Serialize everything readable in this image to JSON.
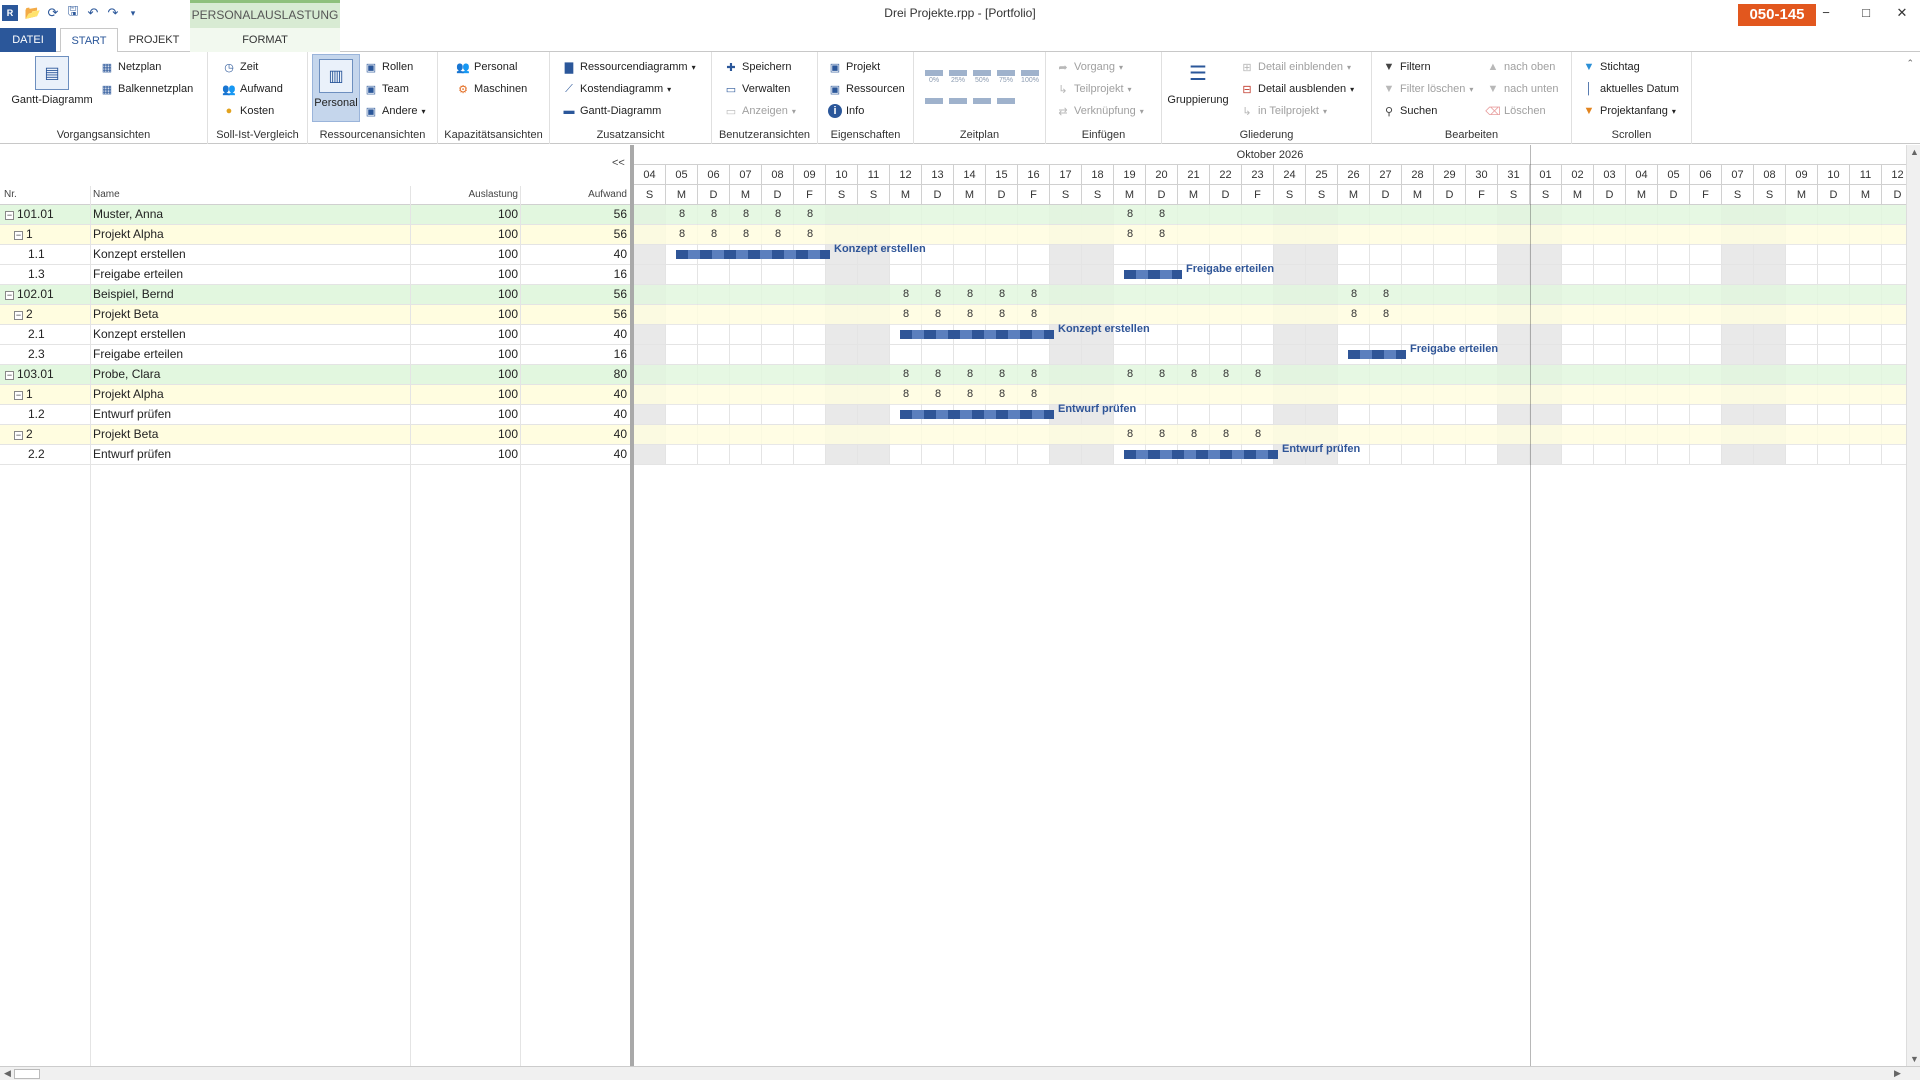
{
  "window": {
    "title": "Drei Projekte.rpp - [Portfolio]",
    "code": "050-145",
    "context_tab": "PERSONALAUSLASTUNG",
    "controls": {
      "min": "−",
      "max": "□",
      "close": "✕"
    }
  },
  "tabs": {
    "datei": "DATEI",
    "start": "START",
    "projekt": "PROJEKT",
    "format": "FORMAT"
  },
  "ribbon": {
    "vorgang": {
      "label": "Vorgangsansichten",
      "gantt": "Gantt-Diagramm",
      "netzplan": "Netzplan",
      "balken": "Balkennetzplan"
    },
    "soll": {
      "label": "Soll-Ist-Vergleich",
      "zeit": "Zeit",
      "aufwand": "Aufwand",
      "kosten": "Kosten"
    },
    "ressourcen": {
      "label": "Ressourcenansichten",
      "personal": "Personal",
      "rollen": "Rollen",
      "team": "Team",
      "andere": "Andere"
    },
    "kapazitaet": {
      "label": "Kapazitätsansichten",
      "personal": "Personal",
      "maschinen": "Maschinen"
    },
    "zusatz": {
      "label": "Zusatzansicht",
      "ressdiag": "Ressourcendiagramm",
      "kostendiag": "Kostendiagramm",
      "gantt": "Gantt-Diagramm"
    },
    "benutzer": {
      "label": "Benutzeransichten",
      "speichern": "Speichern",
      "verwalten": "Verwalten",
      "anzeigen": "Anzeigen"
    },
    "eigen": {
      "label": "Eigenschaften",
      "projekt": "Projekt",
      "ressourcen": "Ressourcen",
      "info": "Info"
    },
    "zeitplan": {
      "label": "Zeitplan",
      "zero": "0%",
      "q25": "25%",
      "q50": "50%",
      "q75": "75%",
      "full": "100%"
    },
    "einfuegen": {
      "label": "Einfügen",
      "vorgang": "Vorgang",
      "teilprojekt": "Teilprojekt",
      "verknuepfung": "Verknüpfung"
    },
    "gliederung": {
      "label": "Gliederung",
      "gruppierung": "Gruppierung",
      "einblenden": "Detail einblenden",
      "ausblenden": "Detail ausblenden",
      "inteil": "in Teilprojekt"
    },
    "bearbeiten": {
      "label": "Bearbeiten",
      "filtern": "Filtern",
      "filterloeschen": "Filter löschen",
      "suchen": "Suchen",
      "oben": "nach oben",
      "unten": "nach unten",
      "loeschen": "Löschen"
    },
    "scrollen": {
      "label": "Scrollen",
      "stichtag": "Stichtag",
      "datum": "aktuelles Datum",
      "anfang": "Projektanfang"
    }
  },
  "grid": {
    "headers": {
      "nr": "Nr.",
      "name": "Name",
      "auslastung": "Auslastung",
      "aufwand": "Aufwand"
    },
    "collapse": "<<",
    "rows": [
      {
        "type": "res",
        "toggle": "−",
        "nr": "101.01",
        "name": "Muster, Anna",
        "auslastung": "100",
        "aufwand": "56"
      },
      {
        "type": "proj",
        "toggle": "−",
        "nr": "1",
        "name": "Projekt Alpha",
        "auslastung": "100",
        "aufwand": "56"
      },
      {
        "type": "task",
        "nr": "1.1",
        "name": "Konzept erstellen",
        "auslastung": "100",
        "aufwand": "40"
      },
      {
        "type": "task",
        "nr": "1.3",
        "name": "Freigabe erteilen",
        "auslastung": "100",
        "aufwand": "16"
      },
      {
        "type": "res",
        "toggle": "−",
        "nr": "102.01",
        "name": "Beispiel, Bernd",
        "auslastung": "100",
        "aufwand": "56"
      },
      {
        "type": "proj",
        "toggle": "−",
        "nr": "2",
        "name": "Projekt Beta",
        "auslastung": "100",
        "aufwand": "56"
      },
      {
        "type": "task",
        "nr": "2.1",
        "name": "Konzept erstellen",
        "auslastung": "100",
        "aufwand": "40"
      },
      {
        "type": "task",
        "nr": "2.3",
        "name": "Freigabe erteilen",
        "auslastung": "100",
        "aufwand": "16"
      },
      {
        "type": "res",
        "toggle": "−",
        "nr": "103.01",
        "name": "Probe, Clara",
        "auslastung": "100",
        "aufwand": "80"
      },
      {
        "type": "proj",
        "toggle": "−",
        "nr": "1",
        "name": "Projekt Alpha",
        "auslastung": "100",
        "aufwand": "40"
      },
      {
        "type": "task",
        "nr": "1.2",
        "name": "Entwurf prüfen",
        "auslastung": "100",
        "aufwand": "40"
      },
      {
        "type": "proj",
        "toggle": "−",
        "nr": "2",
        "name": "Projekt Beta",
        "auslastung": "100",
        "aufwand": "40"
      },
      {
        "type": "task",
        "nr": "2.2",
        "name": "Entwurf prüfen",
        "auslastung": "100",
        "aufwand": "40"
      }
    ]
  },
  "timeline": {
    "month": "Oktober 2026",
    "days": [
      "04",
      "05",
      "06",
      "07",
      "08",
      "09",
      "10",
      "11",
      "12",
      "13",
      "14",
      "15",
      "16",
      "17",
      "18",
      "19",
      "20",
      "21",
      "22",
      "23",
      "24",
      "25",
      "26",
      "27",
      "28",
      "29",
      "30",
      "31",
      "01",
      "02",
      "03",
      "04",
      "05",
      "06",
      "07",
      "08",
      "09",
      "10",
      "11",
      "12"
    ],
    "weekdays": [
      "S",
      "M",
      "D",
      "M",
      "D",
      "F",
      "S",
      "S",
      "M",
      "D",
      "M",
      "D",
      "F",
      "S",
      "S",
      "M",
      "D",
      "M",
      "D",
      "F",
      "S",
      "S",
      "M",
      "D",
      "M",
      "D",
      "F",
      "S",
      "S",
      "M",
      "D",
      "M",
      "D",
      "F",
      "S",
      "S",
      "M",
      "D",
      "M",
      "D"
    ],
    "hours": [
      {
        "row": 0,
        "day_index": [
          1,
          2,
          3,
          4,
          5,
          15,
          16
        ],
        "value": "8"
      },
      {
        "row": 1,
        "day_index": [
          1,
          2,
          3,
          4,
          5,
          15,
          16
        ],
        "value": "8"
      },
      {
        "row": 4,
        "day_index": [
          8,
          9,
          10,
          11,
          12,
          22,
          23
        ],
        "value": "8"
      },
      {
        "row": 5,
        "day_index": [
          8,
          9,
          10,
          11,
          12,
          22,
          23
        ],
        "value": "8"
      },
      {
        "row": 8,
        "day_index": [
          8,
          9,
          10,
          11,
          12,
          15,
          16,
          17,
          18,
          19
        ],
        "value": "8"
      },
      {
        "row": 9,
        "day_index": [
          8,
          9,
          10,
          11,
          12
        ],
        "value": "8"
      },
      {
        "row": 11,
        "day_index": [
          15,
          16,
          17,
          18,
          19
        ],
        "value": "8"
      }
    ],
    "bars": [
      {
        "row": 2,
        "start": 1,
        "end": 5,
        "label": "Konzept erstellen"
      },
      {
        "row": 3,
        "start": 15,
        "end": 16,
        "label": "Freigabe erteilen"
      },
      {
        "row": 6,
        "start": 8,
        "end": 12,
        "label": "Konzept erstellen"
      },
      {
        "row": 7,
        "start": 22,
        "end": 23,
        "label": "Freigabe erteilen"
      },
      {
        "row": 10,
        "start": 8,
        "end": 12,
        "label": "Entwurf prüfen"
      },
      {
        "row": 12,
        "start": 15,
        "end": 19,
        "label": "Entwurf prüfen"
      }
    ]
  },
  "colors": {
    "accent": "#2b579a",
    "badge": "#e2571e",
    "resource_row": "#e2f7df",
    "project_row": "#fffde0",
    "bar": "#2f5597"
  }
}
